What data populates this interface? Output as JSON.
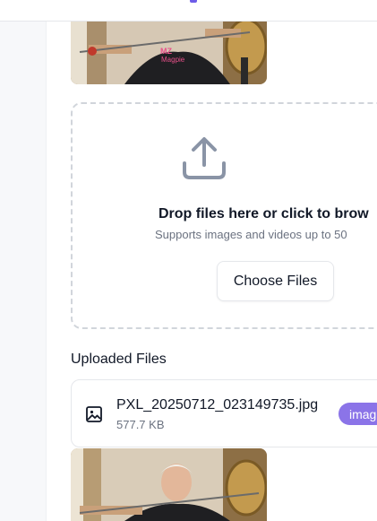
{
  "upload": {
    "dropzone_title": "Drop files here or click to brow",
    "dropzone_subtitle": "Supports images and videos up to 50",
    "choose_button": "Choose Files"
  },
  "uploaded": {
    "title": "Uploaded Files",
    "files": [
      {
        "name": "PXL_20250712_023149735.jpg",
        "size": "577.7 KB",
        "type_badge": "imag"
      }
    ]
  },
  "photo": {
    "shirt_text_line1": "MZ",
    "shirt_text_line2": "Magpie"
  },
  "colors": {
    "accent": "#8b74e8",
    "brand": "#6d5ce8",
    "muted_text": "#6b7280",
    "border": "#e5e7eb"
  }
}
